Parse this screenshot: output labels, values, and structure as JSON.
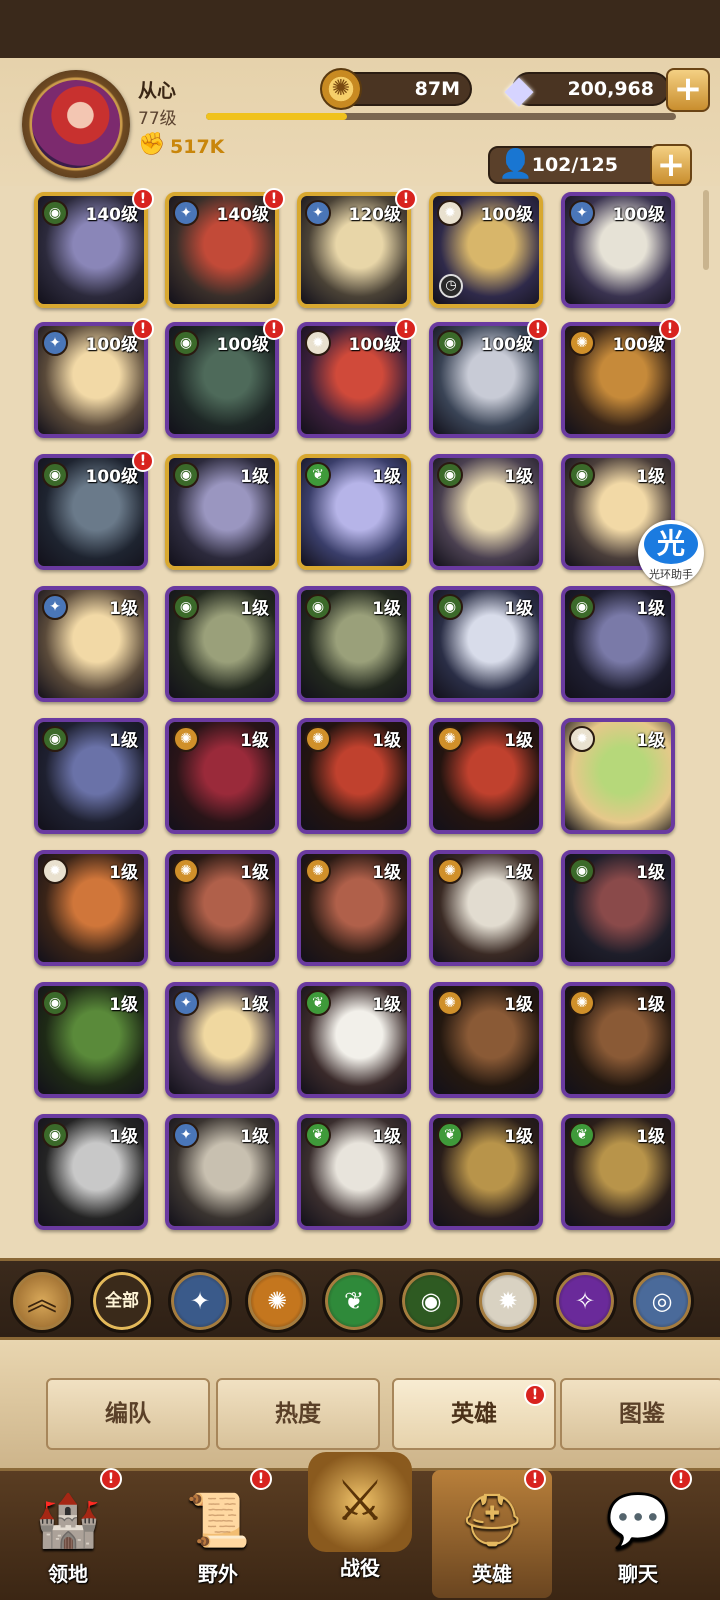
{
  "player": {
    "name": "从心",
    "level": "77级",
    "power": "517K",
    "exp_progress": 0.3
  },
  "resources": {
    "gold": "87M",
    "gems": "200,968",
    "roster": "102/125"
  },
  "colors": {
    "purple_frame": "#6a3aa0",
    "gold_frame": "#d8a830",
    "alert_red": "#d8231f",
    "accent_gold": "#f0c21d"
  },
  "assistant": {
    "label": "光环助手",
    "logo": "光"
  },
  "factions": {
    "lightbearer": {
      "color": "#4a76b8",
      "glyph": "✦"
    },
    "wilder": {
      "color": "#3f9a3a",
      "glyph": "❦"
    },
    "graveborn": {
      "color": "#3b6a2a",
      "glyph": "◉"
    },
    "mauler": {
      "color": "#d0902a",
      "glyph": "✺"
    },
    "celestial": {
      "color": "#e9e1cf",
      "glyph": "✹"
    },
    "hypogean": {
      "color": "#7a3bb0",
      "glyph": "✧"
    },
    "dimensional": {
      "color": "#5878a8",
      "glyph": "◎"
    }
  },
  "heroes": [
    {
      "level": "140级",
      "faction": "graveborn",
      "frame": "gold",
      "alert": true,
      "palette": [
        "#8a86b8",
        "#2c2a3c"
      ]
    },
    {
      "level": "140级",
      "faction": "lightbearer",
      "frame": "gold",
      "alert": true,
      "palette": [
        "#c24a38",
        "#3a2f2a"
      ]
    },
    {
      "level": "120级",
      "faction": "lightbearer",
      "frame": "gold",
      "alert": true,
      "palette": [
        "#e8d6a8",
        "#4a4236"
      ]
    },
    {
      "level": "100级",
      "faction": "celestial",
      "frame": "gold",
      "alert": false,
      "clock": true,
      "palette": [
        "#d8b66a",
        "#2f2a4a"
      ]
    },
    {
      "level": "100级",
      "faction": "lightbearer",
      "frame": "purple",
      "alert": false,
      "palette": [
        "#e6e2d6",
        "#3a3350"
      ]
    },
    {
      "level": "100级",
      "faction": "lightbearer",
      "frame": "purple",
      "alert": true,
      "palette": [
        "#f2d9a6",
        "#5a4a3a"
      ]
    },
    {
      "level": "100级",
      "faction": "graveborn",
      "frame": "purple",
      "alert": true,
      "palette": [
        "#4e6a5a",
        "#1e2826"
      ]
    },
    {
      "level": "100级",
      "faction": "celestial",
      "frame": "purple",
      "alert": true,
      "palette": [
        "#d04a3a",
        "#3a1f3a"
      ]
    },
    {
      "level": "100级",
      "faction": "graveborn",
      "frame": "purple",
      "alert": true,
      "palette": [
        "#c8cbd6",
        "#3a4456"
      ]
    },
    {
      "level": "100级",
      "faction": "mauler",
      "frame": "purple",
      "alert": true,
      "palette": [
        "#c68a3a",
        "#3a2618"
      ]
    },
    {
      "level": "100级",
      "faction": "graveborn",
      "frame": "purple",
      "alert": true,
      "palette": [
        "#6a7a8a",
        "#1e2430"
      ]
    },
    {
      "level": "1级",
      "faction": "graveborn",
      "frame": "gold",
      "alert": false,
      "palette": [
        "#9a96c0",
        "#2c2a3c"
      ]
    },
    {
      "level": "1级",
      "faction": "wilder",
      "frame": "gold",
      "alert": false,
      "palette": [
        "#b6b4e8",
        "#3a3e6a"
      ]
    },
    {
      "level": "1级",
      "faction": "graveborn",
      "frame": "purple",
      "alert": false,
      "palette": [
        "#e8d8b0",
        "#4a4050"
      ]
    },
    {
      "level": "1级",
      "faction": "graveborn",
      "frame": "purple",
      "alert": false,
      "palette": [
        "#f2d9a6",
        "#4a3e3a"
      ]
    },
    {
      "level": "1级",
      "faction": "lightbearer",
      "frame": "purple",
      "alert": false,
      "palette": [
        "#f2d9a6",
        "#5a4a3a"
      ]
    },
    {
      "level": "1级",
      "faction": "graveborn",
      "frame": "purple",
      "alert": false,
      "palette": [
        "#9aa07a",
        "#22281e"
      ]
    },
    {
      "level": "1级",
      "faction": "graveborn",
      "frame": "purple",
      "alert": false,
      "palette": [
        "#9aa07a",
        "#22281e"
      ]
    },
    {
      "level": "1级",
      "faction": "graveborn",
      "frame": "purple",
      "alert": false,
      "palette": [
        "#d8dcea",
        "#2a2e46"
      ]
    },
    {
      "level": "1级",
      "faction": "graveborn",
      "frame": "purple",
      "alert": false,
      "palette": [
        "#7a7aa8",
        "#1e1e30"
      ]
    },
    {
      "level": "1级",
      "faction": "graveborn",
      "frame": "purple",
      "alert": false,
      "palette": [
        "#6a72a8",
        "#1e2030"
      ]
    },
    {
      "level": "1级",
      "faction": "mauler",
      "frame": "purple",
      "alert": false,
      "palette": [
        "#9a2a3a",
        "#2a1418"
      ]
    },
    {
      "level": "1级",
      "faction": "mauler",
      "frame": "purple",
      "alert": false,
      "palette": [
        "#c0412e",
        "#241410"
      ]
    },
    {
      "level": "1级",
      "faction": "mauler",
      "frame": "purple",
      "alert": false,
      "palette": [
        "#c0412e",
        "#241410"
      ]
    },
    {
      "level": "1级",
      "faction": "celestial",
      "frame": "purple",
      "alert": false,
      "palette": [
        "#b6d87a",
        "#e6c88a"
      ]
    },
    {
      "level": "1级",
      "faction": "celestial",
      "frame": "purple",
      "alert": false,
      "palette": [
        "#d0763a",
        "#3a2418"
      ]
    },
    {
      "level": "1级",
      "faction": "mauler",
      "frame": "purple",
      "alert": false,
      "palette": [
        "#b0604a",
        "#2a1a14"
      ]
    },
    {
      "level": "1级",
      "faction": "mauler",
      "frame": "purple",
      "alert": false,
      "palette": [
        "#b0604a",
        "#2a1a14"
      ]
    },
    {
      "level": "1级",
      "faction": "mauler",
      "frame": "purple",
      "alert": false,
      "palette": [
        "#e2dcd0",
        "#3a2a24"
      ]
    },
    {
      "level": "1级",
      "faction": "graveborn",
      "frame": "purple",
      "alert": false,
      "palette": [
        "#8a4a4a",
        "#1e1e2a"
      ]
    },
    {
      "level": "1级",
      "faction": "graveborn",
      "frame": "purple",
      "alert": false,
      "palette": [
        "#5a8a3a",
        "#1e2a16"
      ]
    },
    {
      "level": "1级",
      "faction": "lightbearer",
      "frame": "purple",
      "alert": false,
      "palette": [
        "#f0d8a0",
        "#3a3040"
      ]
    },
    {
      "level": "1级",
      "faction": "wilder",
      "frame": "purple",
      "alert": false,
      "palette": [
        "#f2f0ea",
        "#3a2a2a"
      ]
    },
    {
      "level": "1级",
      "faction": "mauler",
      "frame": "purple",
      "alert": false,
      "palette": [
        "#8a5a36",
        "#241810"
      ]
    },
    {
      "level": "1级",
      "faction": "mauler",
      "frame": "purple",
      "alert": false,
      "palette": [
        "#8a5a36",
        "#241810"
      ]
    },
    {
      "level": "1级",
      "faction": "graveborn",
      "frame": "purple",
      "alert": false,
      "palette": [
        "#c8c8c8",
        "#242424"
      ]
    },
    {
      "level": "1级",
      "faction": "lightbearer",
      "frame": "purple",
      "alert": false,
      "palette": [
        "#c8c0b0",
        "#3a3430"
      ]
    },
    {
      "level": "1级",
      "faction": "wilder",
      "frame": "purple",
      "alert": false,
      "palette": [
        "#e8e4dc",
        "#3a2e2e"
      ]
    },
    {
      "level": "1级",
      "faction": "wilder",
      "frame": "purple",
      "alert": false,
      "palette": [
        "#b8944a",
        "#2a1e1a"
      ]
    },
    {
      "level": "1级",
      "faction": "wilder",
      "frame": "purple",
      "alert": false,
      "palette": [
        "#b8944a",
        "#2a1e1a"
      ]
    }
  ],
  "filters": {
    "collapse_glyph": "︽",
    "all_label": "全部",
    "items": [
      {
        "name": "lightbearer",
        "glyph": "✦",
        "color": "#3a5a8a"
      },
      {
        "name": "mauler",
        "glyph": "✺",
        "color": "#c4761e"
      },
      {
        "name": "wilder",
        "glyph": "❦",
        "color": "#2f8a3a"
      },
      {
        "name": "graveborn",
        "glyph": "◉",
        "color": "#2e5a22"
      },
      {
        "name": "celestial",
        "glyph": "✹",
        "color": "#d9d2c2"
      },
      {
        "name": "hypogean",
        "glyph": "✧",
        "color": "#6a2a9a"
      },
      {
        "name": "dimensional",
        "glyph": "◎",
        "color": "#4a6a9a"
      }
    ]
  },
  "subtabs": [
    {
      "label": "编队",
      "active": false
    },
    {
      "label": "热度",
      "active": false
    },
    {
      "label": "英雄",
      "active": true,
      "alert": true
    },
    {
      "label": "图鉴",
      "active": false
    }
  ],
  "nav": [
    {
      "label": "领地",
      "icon": "castle-icon",
      "glyph": "🏰",
      "alert": true
    },
    {
      "label": "野外",
      "icon": "scroll-map-icon",
      "glyph": "📜",
      "alert": true
    },
    {
      "label": "战役",
      "icon": "crossed-swords-icon",
      "glyph": "⚔",
      "center": true
    },
    {
      "label": "英雄",
      "icon": "helmet-icon",
      "glyph": "⛑",
      "alert": true,
      "active": true
    },
    {
      "label": "聊天",
      "icon": "chat-bubble-icon",
      "glyph": "💬",
      "alert": true
    }
  ]
}
